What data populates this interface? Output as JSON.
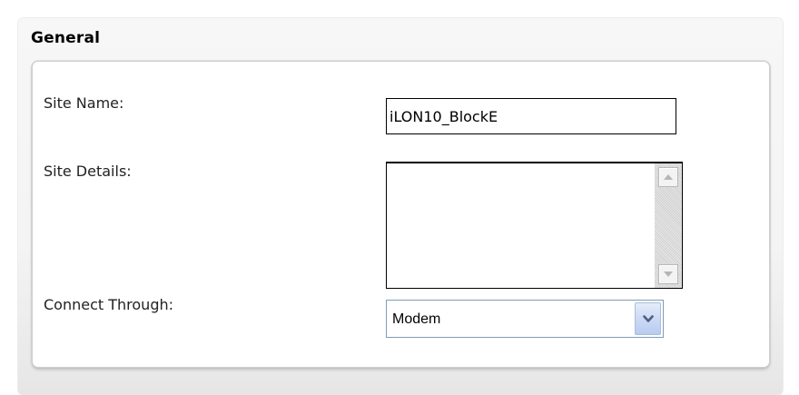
{
  "section": {
    "title": "General"
  },
  "fields": {
    "site_name_label": "Site Name:",
    "site_name_value": "iLON10_BlockE",
    "site_details_label": "Site Details:",
    "site_details_value": "",
    "connect_through_label": "Connect Through:",
    "connect_through_selected": "Modem"
  },
  "icons": {
    "scroll_up": "arrow-up-icon",
    "scroll_down": "arrow-down-icon",
    "dropdown": "chevron-down-icon"
  },
  "colors": {
    "dropdown_arrow": "#4d6185",
    "select_border": "#7f9db9"
  }
}
